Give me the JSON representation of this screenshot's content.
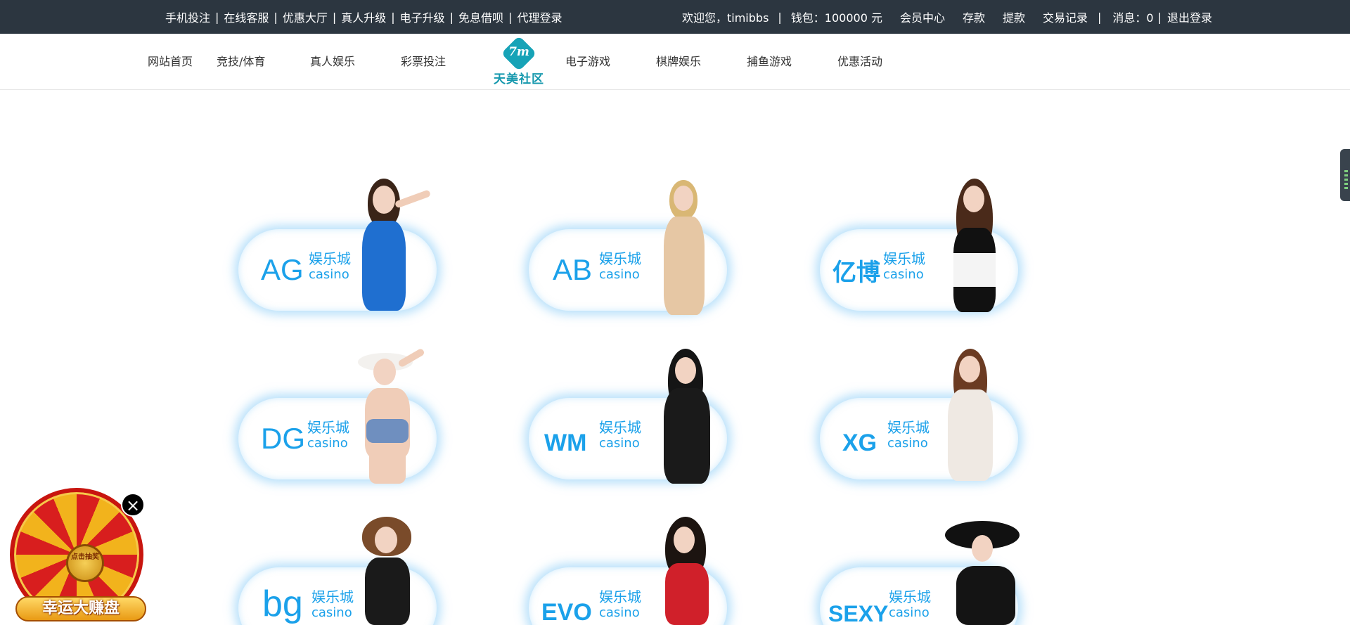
{
  "topbar": {
    "links": [
      "手机投注",
      "在线客服",
      "优惠大厅",
      "真人升级",
      "电子升级",
      "免息借呗",
      "代理登录"
    ],
    "separator": "|",
    "welcome": "欢迎您，timibbs",
    "wallet": "钱包：100000 元",
    "member_center": "会员中心",
    "deposit": "存款",
    "withdraw": "提款",
    "transactions": "交易记录",
    "messages": "消息：0",
    "logout": "退出登录"
  },
  "nav": {
    "items": [
      "网站首页",
      "竞技/体育",
      "真人娱乐",
      "彩票投注",
      "电子游戏",
      "棋牌娱乐",
      "捕鱼游戏",
      "优惠活动"
    ],
    "logo_mark": "7m",
    "logo_text": "天美社区"
  },
  "cards": [
    {
      "brand": "AG",
      "cn": "娱乐城",
      "en": "casino"
    },
    {
      "brand": "AB",
      "cn": "娱乐城",
      "en": "casino"
    },
    {
      "brand": "亿博",
      "cn": "娱乐城",
      "en": "casino"
    },
    {
      "brand": "DG",
      "cn": "娱乐城",
      "en": "casino"
    },
    {
      "brand": "WM",
      "cn": "娱乐城",
      "en": "casino"
    },
    {
      "brand": "XG",
      "cn": "娱乐城",
      "en": "casino"
    },
    {
      "brand": "bg",
      "cn": "娱乐城",
      "en": "casino"
    },
    {
      "brand": "EVO",
      "cn": "娱乐城",
      "en": "casino"
    },
    {
      "brand": "SEXY",
      "cn": "娱乐城",
      "en": "casino"
    }
  ],
  "wheel": {
    "hub_text": "点击抽奖",
    "label": "幸运大赚盘",
    "close_icon": "close-icon"
  },
  "colors": {
    "topbar_bg": "#2c3640",
    "brand_blue": "#1ba1ea",
    "logo_teal": "#17a3b7"
  }
}
